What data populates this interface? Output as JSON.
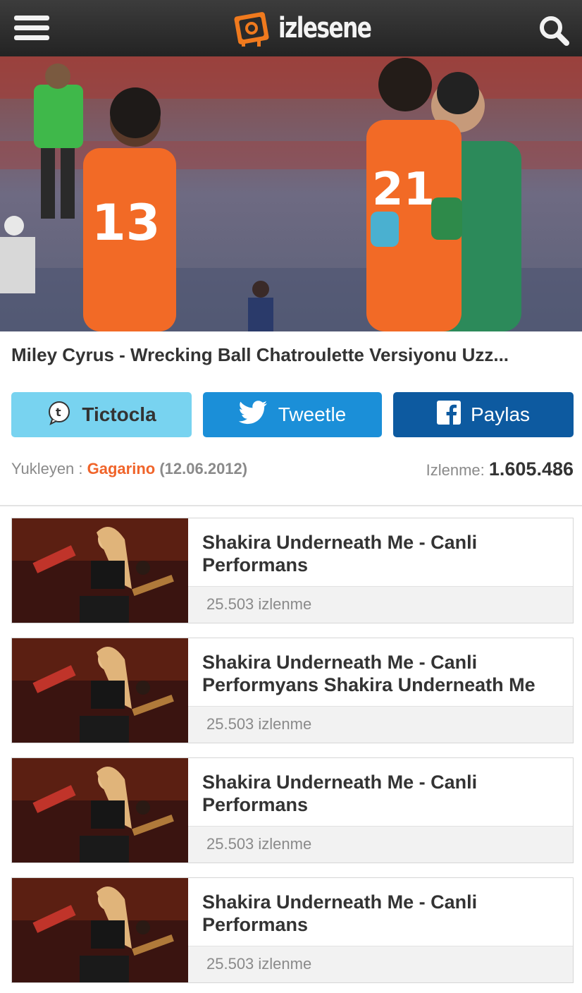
{
  "header": {
    "logo_text": "izlesene"
  },
  "video": {
    "title": "Miley Cyrus - Wrecking Ball Chatroulette Versiyonu Uzz...",
    "uploader_label": "Yukleyen :",
    "uploader": "Gagarino",
    "date": "(12.06.2012)",
    "views_label": "Izlenme:",
    "views": "1.605.486"
  },
  "share": {
    "tictoc": "Tictocla",
    "tweet": "Tweetle",
    "facebook": "Paylas"
  },
  "colors": {
    "accent": "#f0642a",
    "tictoc": "#78d3f0",
    "twitter": "#1b8fd8",
    "facebook": "#0d5aa0",
    "header": "#2e2e2e"
  },
  "related": [
    {
      "title": "Shakira Underneath Me - Canli Performans",
      "views": "25.503 izlenme"
    },
    {
      "title": "Shakira Underneath Me - Canli Performyans Shakira Underneath Me",
      "views": "25.503 izlenme"
    },
    {
      "title": "Shakira Underneath Me - Canli Performans",
      "views": "25.503 izlenme"
    },
    {
      "title": "Shakira Underneath Me - Canli Performans",
      "views": "25.503 izlenme"
    }
  ]
}
